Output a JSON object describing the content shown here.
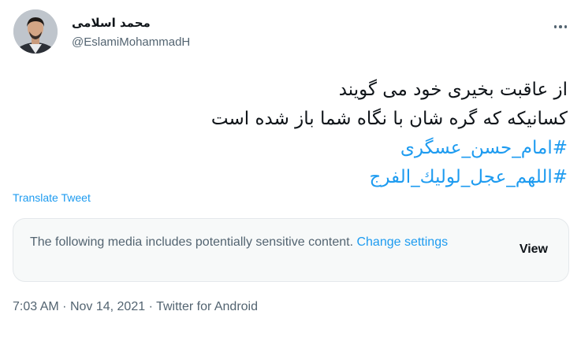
{
  "author": {
    "display_name": "محمد اسلامی",
    "handle": "@EslamiMohammadH"
  },
  "tweet": {
    "lines": [
      "از عاقبت بخیری خود می گویند",
      "کسانیکه که گره شان با نگاه شما باز شده است"
    ],
    "hashtags": [
      "#امام_حسن_عسگری",
      "#اللهم_عجل_لوليك_الفرج"
    ],
    "translate_label": "Translate Tweet"
  },
  "sensitive_notice": {
    "text": "The following media includes potentially sensitive content.",
    "link_label": "Change settings",
    "view_label": "View"
  },
  "meta": {
    "time": "7:03 AM",
    "separator": "·",
    "date": "Nov 14, 2021",
    "source": "Twitter for Android"
  },
  "colors": {
    "link": "#1d9bf0",
    "secondary_text": "#536471",
    "primary_text": "#0f1419"
  }
}
